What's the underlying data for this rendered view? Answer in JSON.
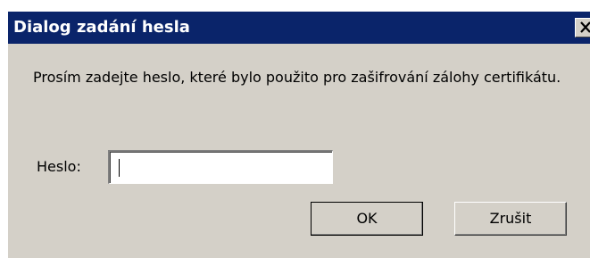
{
  "dialog": {
    "title": "Dialog zadání hesla",
    "close_icon": "close-icon",
    "message": "Prosím zadejte heslo, které bylo použito pro zašifrování zálohy certifikátu.",
    "password_label": "Heslo:",
    "password_value": "",
    "ok_label": "OK",
    "cancel_label": "Zrušit"
  },
  "colors": {
    "titlebar": "#0a246a",
    "face": "#d4d0c8",
    "title_text": "#ffffff"
  }
}
